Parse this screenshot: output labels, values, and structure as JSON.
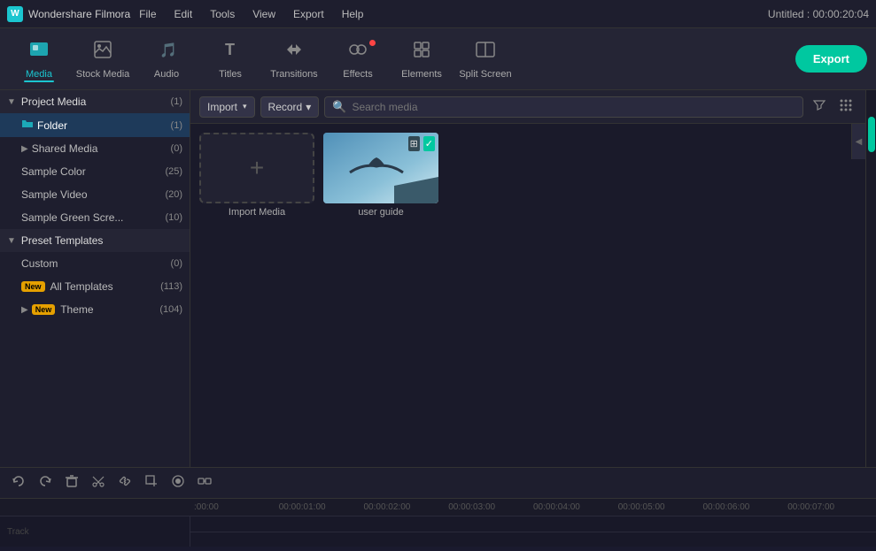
{
  "titlebar": {
    "logo_text": "W",
    "app_name": "Wondershare Filmora",
    "menu_items": [
      "File",
      "Edit",
      "Tools",
      "View",
      "Export",
      "Help"
    ],
    "project_time": "Untitled : 00:00:20:04"
  },
  "toolbar": {
    "items": [
      {
        "id": "media",
        "label": "Media",
        "icon": "media",
        "active": true
      },
      {
        "id": "stock-media",
        "label": "Stock Media",
        "icon": "stock"
      },
      {
        "id": "audio",
        "label": "Audio",
        "icon": "audio"
      },
      {
        "id": "titles",
        "label": "Titles",
        "icon": "titles"
      },
      {
        "id": "transitions",
        "label": "Transitions",
        "icon": "transitions"
      },
      {
        "id": "effects",
        "label": "Effects",
        "icon": "effects",
        "has_badge": true
      },
      {
        "id": "elements",
        "label": "Elements",
        "icon": "elements"
      },
      {
        "id": "split-screen",
        "label": "Split Screen",
        "icon": "split"
      }
    ],
    "export_label": "Export"
  },
  "panel_toolbar": {
    "import_label": "Import",
    "record_label": "Record",
    "search_placeholder": "Search media"
  },
  "sidebar": {
    "project_media": {
      "label": "Project Media",
      "count": "(1)",
      "expanded": true
    },
    "folder": {
      "label": "Folder",
      "count": "(1)"
    },
    "items": [
      {
        "label": "Shared Media",
        "count": "(0)",
        "has_arrow": true
      },
      {
        "label": "Sample Color",
        "count": "(25)"
      },
      {
        "label": "Sample Video",
        "count": "(20)"
      },
      {
        "label": "Sample Green Scre...",
        "count": "(10)"
      }
    ],
    "preset_templates": {
      "label": "Preset Templates",
      "expanded": true
    },
    "template_items": [
      {
        "label": "Custom",
        "count": "(0)"
      },
      {
        "label": "All Templates",
        "count": "(113)",
        "new_badge": true
      },
      {
        "label": "Theme",
        "count": "(104)",
        "new_badge": true,
        "has_arrow": true
      }
    ]
  },
  "media_grid": {
    "import_plus": "+",
    "import_label": "Import Media",
    "thumb_label": "user guide",
    "thumb_icons": [
      "⊞",
      "✓"
    ]
  },
  "timeline": {
    "toolbar_buttons": [
      "↩",
      "↪",
      "🗑",
      "✂",
      "🔗",
      "⊟",
      "⏺",
      "⏮"
    ],
    "ruler_marks": [
      ":00:00",
      "00:00:01:00",
      "00:00:02:00",
      "00:00:03:00",
      "00:00:04:00",
      "00:00:05:00",
      "00:00:06:00",
      "00:00:07:00"
    ]
  },
  "colors": {
    "accent": "#1bc6d0",
    "accent_green": "#00c8a0",
    "active_bg": "#1e3a5a",
    "sidebar_bg": "#1e1e2e",
    "toolbar_bg": "#252535",
    "panel_bg": "#1a1a2a"
  }
}
